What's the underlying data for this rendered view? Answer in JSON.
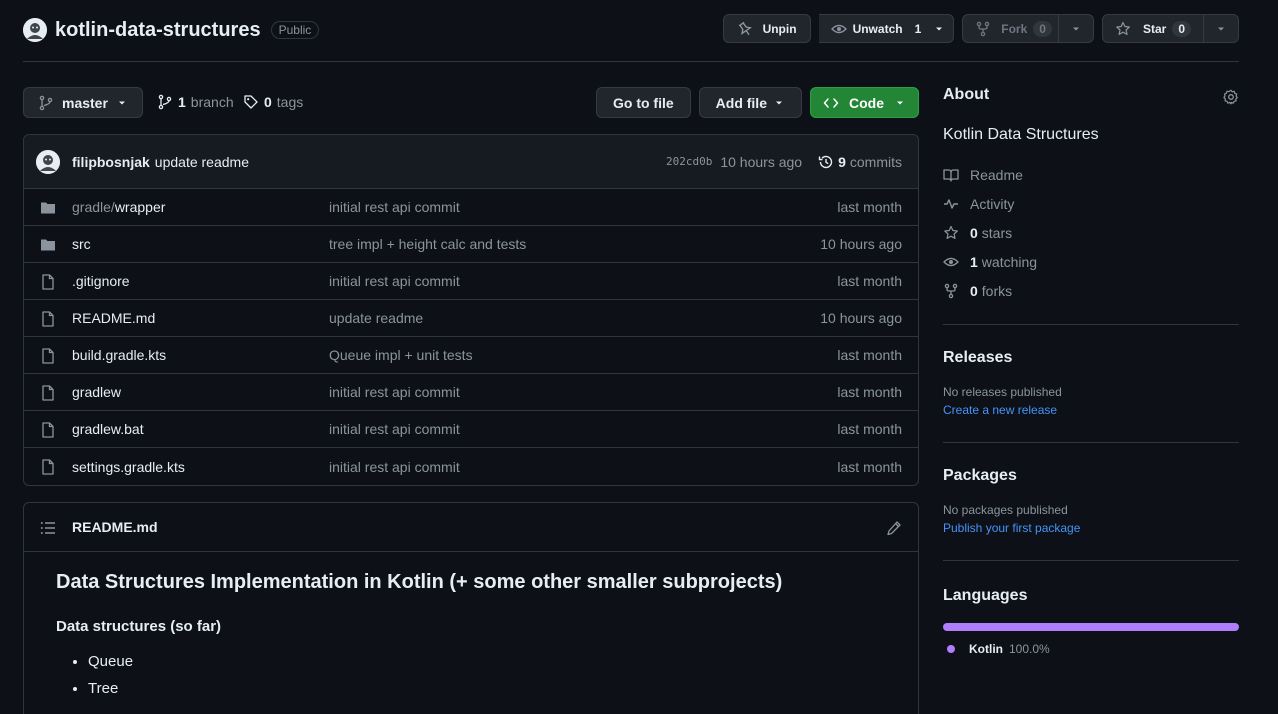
{
  "header": {
    "repo_name": "kotlin-data-structures",
    "visibility": "Public",
    "unpin_label": "Unpin",
    "unwatch_label": "Unwatch",
    "watch_count": "1",
    "fork_label": "Fork",
    "fork_count": "0",
    "star_label": "Star",
    "star_count": "0"
  },
  "toolbar": {
    "branch": "master",
    "branch_count": "1",
    "branch_label": "branch",
    "tag_count": "0",
    "tag_label": "tags",
    "go_to_file": "Go to file",
    "add_file": "Add file",
    "code": "Code"
  },
  "commit": {
    "author": "filipbosnjak",
    "message": "update readme",
    "sha": "202cd0b",
    "time": "10 hours ago",
    "count": "9",
    "count_label": "commits"
  },
  "files": [
    {
      "type": "folder",
      "prefix": "gradle/",
      "name": "wrapper",
      "message": "initial rest api commit",
      "date": "last month"
    },
    {
      "type": "folder",
      "prefix": "",
      "name": "src",
      "message": "tree impl + height calc and tests",
      "date": "10 hours ago"
    },
    {
      "type": "file",
      "prefix": "",
      "name": ".gitignore",
      "message": "initial rest api commit",
      "date": "last month"
    },
    {
      "type": "file",
      "prefix": "",
      "name": "README.md",
      "message": "update readme",
      "date": "10 hours ago"
    },
    {
      "type": "file",
      "prefix": "",
      "name": "build.gradle.kts",
      "message": "Queue impl + unit tests",
      "date": "last month"
    },
    {
      "type": "file",
      "prefix": "",
      "name": "gradlew",
      "message": "initial rest api commit",
      "date": "last month"
    },
    {
      "type": "file",
      "prefix": "",
      "name": "gradlew.bat",
      "message": "initial rest api commit",
      "date": "last month"
    },
    {
      "type": "file",
      "prefix": "",
      "name": "settings.gradle.kts",
      "message": "initial rest api commit",
      "date": "last month"
    }
  ],
  "readme": {
    "filename": "README.md",
    "heading": "Data Structures Implementation in Kotlin (+ some other smaller subprojects)",
    "subheading": "Data structures (so far)",
    "items": [
      "Queue",
      "Tree"
    ]
  },
  "sidebar": {
    "about_title": "About",
    "description": "Kotlin Data Structures",
    "readme_label": "Readme",
    "activity_label": "Activity",
    "stars_count": "0",
    "stars_label": "stars",
    "watching_count": "1",
    "watching_label": "watching",
    "forks_count": "0",
    "forks_label": "forks",
    "releases_title": "Releases",
    "releases_empty": "No releases published",
    "releases_link": "Create a new release",
    "packages_title": "Packages",
    "packages_empty": "No packages published",
    "packages_link": "Publish your first package",
    "languages_title": "Languages",
    "language_name": "Kotlin",
    "language_pct": "100.0%",
    "language_share": 100,
    "language_color": "#b07dfc"
  },
  "colors": {
    "background": "#0d1117",
    "border": "#30363d",
    "accent_green": "#238636",
    "link": "#4493f8"
  }
}
